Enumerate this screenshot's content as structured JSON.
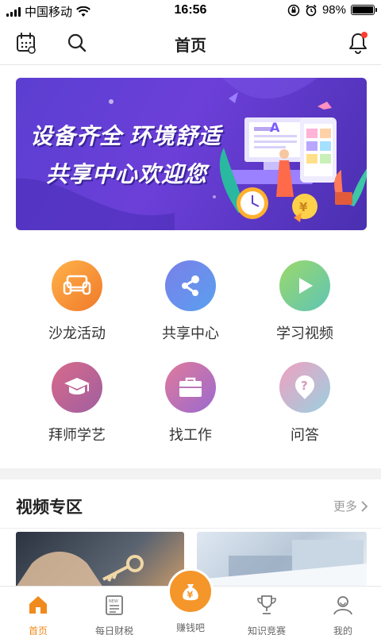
{
  "status_bar": {
    "carrier": "中国移动",
    "time": "16:56",
    "battery": "98%"
  },
  "nav": {
    "title": "首页",
    "icons": [
      "calendar-icon",
      "search-icon",
      "bell-icon"
    ],
    "notification_dot_color": "#ff3b30"
  },
  "banner": {
    "line1": "设备齐全 环境舒适",
    "line2": "共享中心欢迎您"
  },
  "grid": [
    {
      "label": "沙龙活动",
      "icon": "sofa-icon"
    },
    {
      "label": "共享中心",
      "icon": "share-icon"
    },
    {
      "label": "学习视频",
      "icon": "play-icon"
    },
    {
      "label": "拜师学艺",
      "icon": "graduation-cap-icon"
    },
    {
      "label": "找工作",
      "icon": "briefcase-icon"
    },
    {
      "label": "问答",
      "icon": "question-icon"
    }
  ],
  "video_section": {
    "title": "视频专区",
    "more": "更多"
  },
  "tabs": [
    {
      "label": "首页",
      "icon": "home-icon",
      "active": true
    },
    {
      "label": "每日财税",
      "icon": "newspaper-icon",
      "active": false
    },
    {
      "label": "赚钱吧",
      "icon": "money-bag-icon",
      "active": false
    },
    {
      "label": "知识竞赛",
      "icon": "trophy-icon",
      "active": false
    },
    {
      "label": "我的",
      "icon": "user-icon",
      "active": false
    }
  ],
  "colors": {
    "accent": "#f08a1c",
    "banner": "#5b3fd1"
  }
}
